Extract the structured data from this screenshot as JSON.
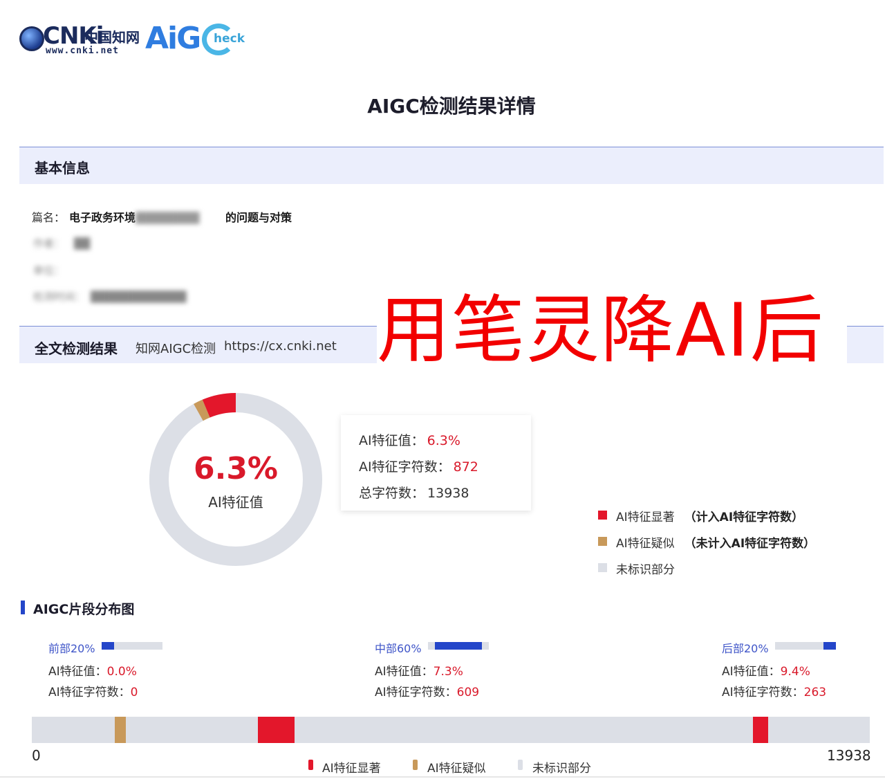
{
  "logo": {
    "cnki_word": "CNKi",
    "cnki_cn": "中国知网",
    "cnki_url": "www.cnki.net",
    "aig_word": "AiG",
    "check_word": "heck"
  },
  "title": "AIGC检测结果详情",
  "basic_info": {
    "section_title": "基本信息",
    "title_label": "篇名：",
    "title_prefix": "电子政务环境",
    "title_blurred": "下",
    "title_suffix": "的问题与对策",
    "author_label": "作者：",
    "author_value": "",
    "unit_label": "单位：",
    "time_label": "检测时间：",
    "time_value": ""
  },
  "fulltext": {
    "section_title": "全文检测结果",
    "service": "知网AIGC检测",
    "url": "https://cx.cnki.net"
  },
  "stamp_text": "用笔灵降AI后",
  "summary": {
    "ai_value_pct": "6.3%",
    "ai_value_label": "AI特征值",
    "ai_value_row_label": "AI特征值：",
    "ai_value_row_value": "6.3%",
    "ai_chars_label": "AI特征字符数：",
    "ai_chars_value": "872",
    "total_chars_label": "总字符数：",
    "total_chars_value": "13938"
  },
  "donut": {
    "significant_fraction": 0.063,
    "suspected_fraction": 0.018,
    "colors": {
      "significant": "#e3172b",
      "suspected": "#c8995a",
      "unmarked": "#dcdfe6"
    }
  },
  "legend": [
    {
      "label": "AI特征显著",
      "note": "（计入AI特征字符数）",
      "color": "#e3172b"
    },
    {
      "label": "AI特征疑似",
      "note": "（未计入AI特征字符数）",
      "color": "#c8995a"
    },
    {
      "label": "未标识部分",
      "note": "",
      "color": "#dcdfe6"
    }
  ],
  "distribution": {
    "title": "AIGC片段分布图",
    "segments": [
      {
        "name": "前部20%",
        "ai_value_label": "AI特征值：",
        "ai_value": "0.0%",
        "chars_label": "AI特征字符数：",
        "chars": "0",
        "fill_fraction": 0.2
      },
      {
        "name": "中部60%",
        "ai_value_label": "AI特征值：",
        "ai_value": "7.3%",
        "chars_label": "AI特征字符数：",
        "chars": "609",
        "fill_fraction": 0.77
      },
      {
        "name": "后部20%",
        "ai_value_label": "AI特征值：",
        "ai_value": "9.4%",
        "chars_label": "AI特征字符数：",
        "chars": "263",
        "fill_fraction": 0.2
      }
    ],
    "strip_min": "0",
    "strip_max": "13938",
    "strip_marks": [
      {
        "type": "suspected",
        "start": 1380,
        "end": 1560,
        "color": "#c8995a"
      },
      {
        "type": "significant",
        "start": 3760,
        "end": 4370,
        "color": "#e3172b"
      },
      {
        "type": "significant",
        "start": 11990,
        "end": 12250,
        "color": "#e3172b"
      }
    ],
    "bottom_legend": [
      {
        "label": "AI特征显著",
        "color": "#e3172b"
      },
      {
        "label": "AI特征疑似",
        "color": "#c8995a"
      },
      {
        "label": "未标识部分",
        "color": "#dcdfe6"
      }
    ]
  }
}
